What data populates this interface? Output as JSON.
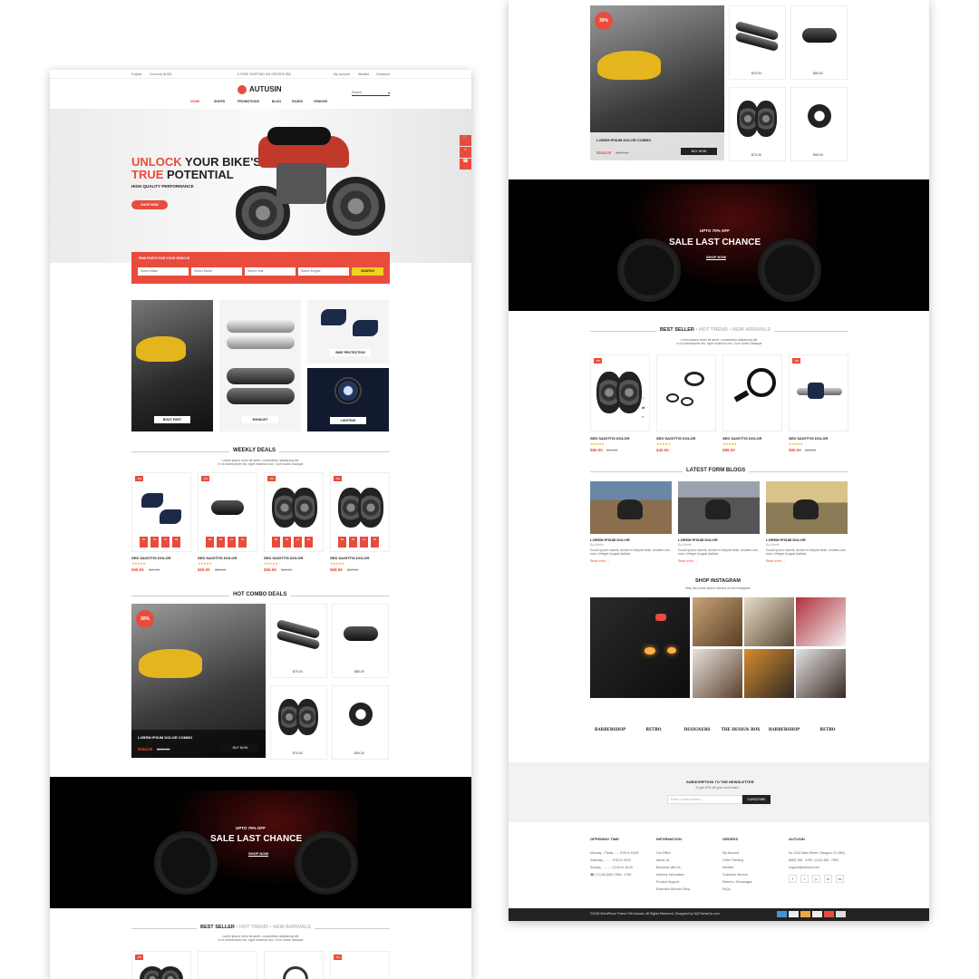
{
  "left": {
    "topbar": {
      "lang": "English",
      "currency": "Currency $USD",
      "promo": "6 FREE SHIPPING ON ORDERS $50",
      "account": "My account",
      "wishlist": "Wishlist",
      "checkout": "Checkout"
    },
    "logo": "AUTUSIN",
    "search_placeholder": "Search",
    "nav": [
      "HOME",
      "SHOPS",
      "PROMOTIONS",
      "BLOG",
      "PAGES",
      "VENDOR"
    ],
    "hero": {
      "line1a": "UNLOCK",
      "line1b": " YOUR BIKE'S",
      "line2a": "TRUE",
      "line2b": " POTENTIAL",
      "sub": "HIGH QUALITY PERFORMANCE",
      "cta": "SHOP NOW"
    },
    "finder": {
      "title": "FIND PARTS FOR YOUR VEHICLE",
      "selects": [
        "Select Make",
        "Select Model",
        "Select Year",
        "Select Engine"
      ],
      "button": "SEARCH"
    },
    "categories": {
      "body": "BODY PART",
      "exhaust": "EXHAUST",
      "bike_protection": "BIKE PROTECTION",
      "lighting": "LIGHTING"
    },
    "weekly": {
      "title": "WEEKLY DEALS",
      "desc1": "Lorem ipsum dolor sit amet, consectetur adipiscing elit.",
      "desc2": "In ut ullamcorper leo, eget euismod orci. Cum sociis natoque",
      "products": [
        {
          "badge": "-5%",
          "name": "SED SAGITTIS DOLOR",
          "price": "$56.55",
          "old": "$65.00",
          "countdown": [
            "58",
            "05",
            "12",
            "56"
          ]
        },
        {
          "badge": "-5%",
          "name": "SED SAGITTIS DOLOR",
          "price": "$60.05",
          "old": "$85.00",
          "countdown": [
            "58",
            "05",
            "12",
            "56"
          ]
        },
        {
          "badge": "-5%",
          "name": "SED SAGITTIS DOLOR",
          "price": "$56.55",
          "old": "$65.00",
          "countdown": [
            "58",
            "05",
            "12",
            "56"
          ]
        },
        {
          "badge": "-5%",
          "name": "SED SAGITTIS DOLOR",
          "price": "$68.55",
          "old": "$85.00",
          "countdown": [
            "58",
            "05",
            "12",
            "56"
          ]
        }
      ]
    },
    "combo": {
      "title": "HOT COMBO DEALS",
      "badge": "30%",
      "name": "LOREM IPSUM DOLOR COMBO",
      "price": "$154.00",
      "old": "$220.00",
      "buy": "BUY NOW",
      "items": [
        "$70.00",
        "$80.00",
        "$70.00",
        "$90.00"
      ]
    },
    "sale": {
      "small": "UPTO 70% OFF",
      "big": "SALE LAST CHANCE",
      "cta": "SHOP NOW"
    },
    "tabs": [
      "BEST SELLER",
      "HOT TREND",
      "NEW ARRIVALS"
    ],
    "tabs_desc1": "Lorem ipsum dolor sit amet, consectetur adipiscing elit.",
    "tabs_desc2": "In ut ullamcorper leo, eget euismod orci. Cum sociis natoque"
  },
  "right": {
    "combo": {
      "badge": "30%",
      "name": "LOREM IPSUM DOLOR COMBO",
      "price": "$154.00",
      "old": "$220.00",
      "buy": "BUY NOW",
      "items": [
        "$70.00",
        "$80.00",
        "$70.00",
        "$90.00"
      ]
    },
    "sale": {
      "small": "UPTO 70% OFF",
      "big": "SALE LAST CHANCE",
      "cta": "SHOP NOW"
    },
    "tabs": [
      "BEST SELLER",
      "HOT TREND",
      "NEW ARRIVALS"
    ],
    "tabs_desc1": "Lorem ipsum dolor sit amet, consectetur adipiscing elit.",
    "tabs_desc2": "In ut ullamcorper leo, eget euismod orci. Cum sociis natoque",
    "best": [
      {
        "badge": "-5%",
        "name": "SED SAGITTIS DOLOR",
        "price": "$80.00",
        "old": "$99.00"
      },
      {
        "badge": "",
        "name": "SED SAGITTIS DOLOR",
        "price": "$40.00",
        "old": ""
      },
      {
        "badge": "",
        "name": "SED SAGITTIS DOLOR",
        "price": "$85.00",
        "old": ""
      },
      {
        "badge": "-5%",
        "name": "SED SAGITTIS DOLOR",
        "price": "$90.00",
        "old": "$95.00"
      }
    ],
    "blogs": {
      "title": "LATEST FORM BLOGS",
      "posts": [
        {
          "title": "LOREM IPSUM DOLOR",
          "meta": "By Admin",
          "text": "Fusce ipsum mauris, dictum et aliquet vitae, sodales sed enim. Integer feugiat facilisis.",
          "more": "Read more →"
        },
        {
          "title": "LOREM IPSUM DOLOR",
          "meta": "By Admin",
          "text": "Fusce ipsum mauris, dictum et aliquet vitae, sodales sed enim. Integer feugiat facilisis.",
          "more": "Read more →"
        },
        {
          "title": "LOREM IPSUM DOLOR",
          "meta": "By Admin",
          "text": "Fusce ipsum mauris, dictum et aliquet vitae, sodales sed enim. Integer feugiat facilisis.",
          "more": "Read more →"
        }
      ]
    },
    "instagram": {
      "title": "SHOP INSTAGRAM",
      "desc": "Help like posts that is offered on the Instagram"
    },
    "brands": [
      "BARBERSHOP",
      "RETRO",
      "DESIGNERS",
      "THE DESIGN BOX",
      "BARBERSHOP",
      "RETRO"
    ],
    "newsletter": {
      "title": "SUBSCRIPTION TO THE NEWSLETTER",
      "sub": "To get 10% off your next order!",
      "placeholder": "Enter a valid address...",
      "button": "SUBSCRIBE"
    },
    "footer": {
      "col1": {
        "title": "OPPENING TIME",
        "lines": [
          "Monday - Friday ...... 8:00 to 18:00",
          "Saturday ......... 9:00 to 18:00",
          "Sunday ........... 12:00 to 18:00"
        ],
        "phone": "(+1) 66 (681) 7566 - 4789"
      },
      "col2": {
        "title": "INFORMATION",
        "lines": [
          "Our Office",
          "About Us",
          "Business with Us",
          "Delivery Information",
          "Product Support",
          "Extended Service Plans"
        ]
      },
      "col3": {
        "title": "ORDERS",
        "lines": [
          "My Account",
          "Order Tracking",
          "Wishlist",
          "Customer Service",
          "Returns / Exchanges",
          "FAQs"
        ]
      },
      "col4": {
        "title": "AUTUSIN",
        "lines": [
          "No 1234 Main Street, Glasgow, D1 8NQ",
          "(880) 268 - 4789 / (123) 456 - 7890",
          "support@autusin.com"
        ]
      },
      "social": [
        "f",
        "t",
        "p",
        "in",
        "tw"
      ],
      "copyright": "©2018 WordPress Theme SW Autusin. All Rights Reserved. Designed by WpThemeGo.com"
    }
  }
}
